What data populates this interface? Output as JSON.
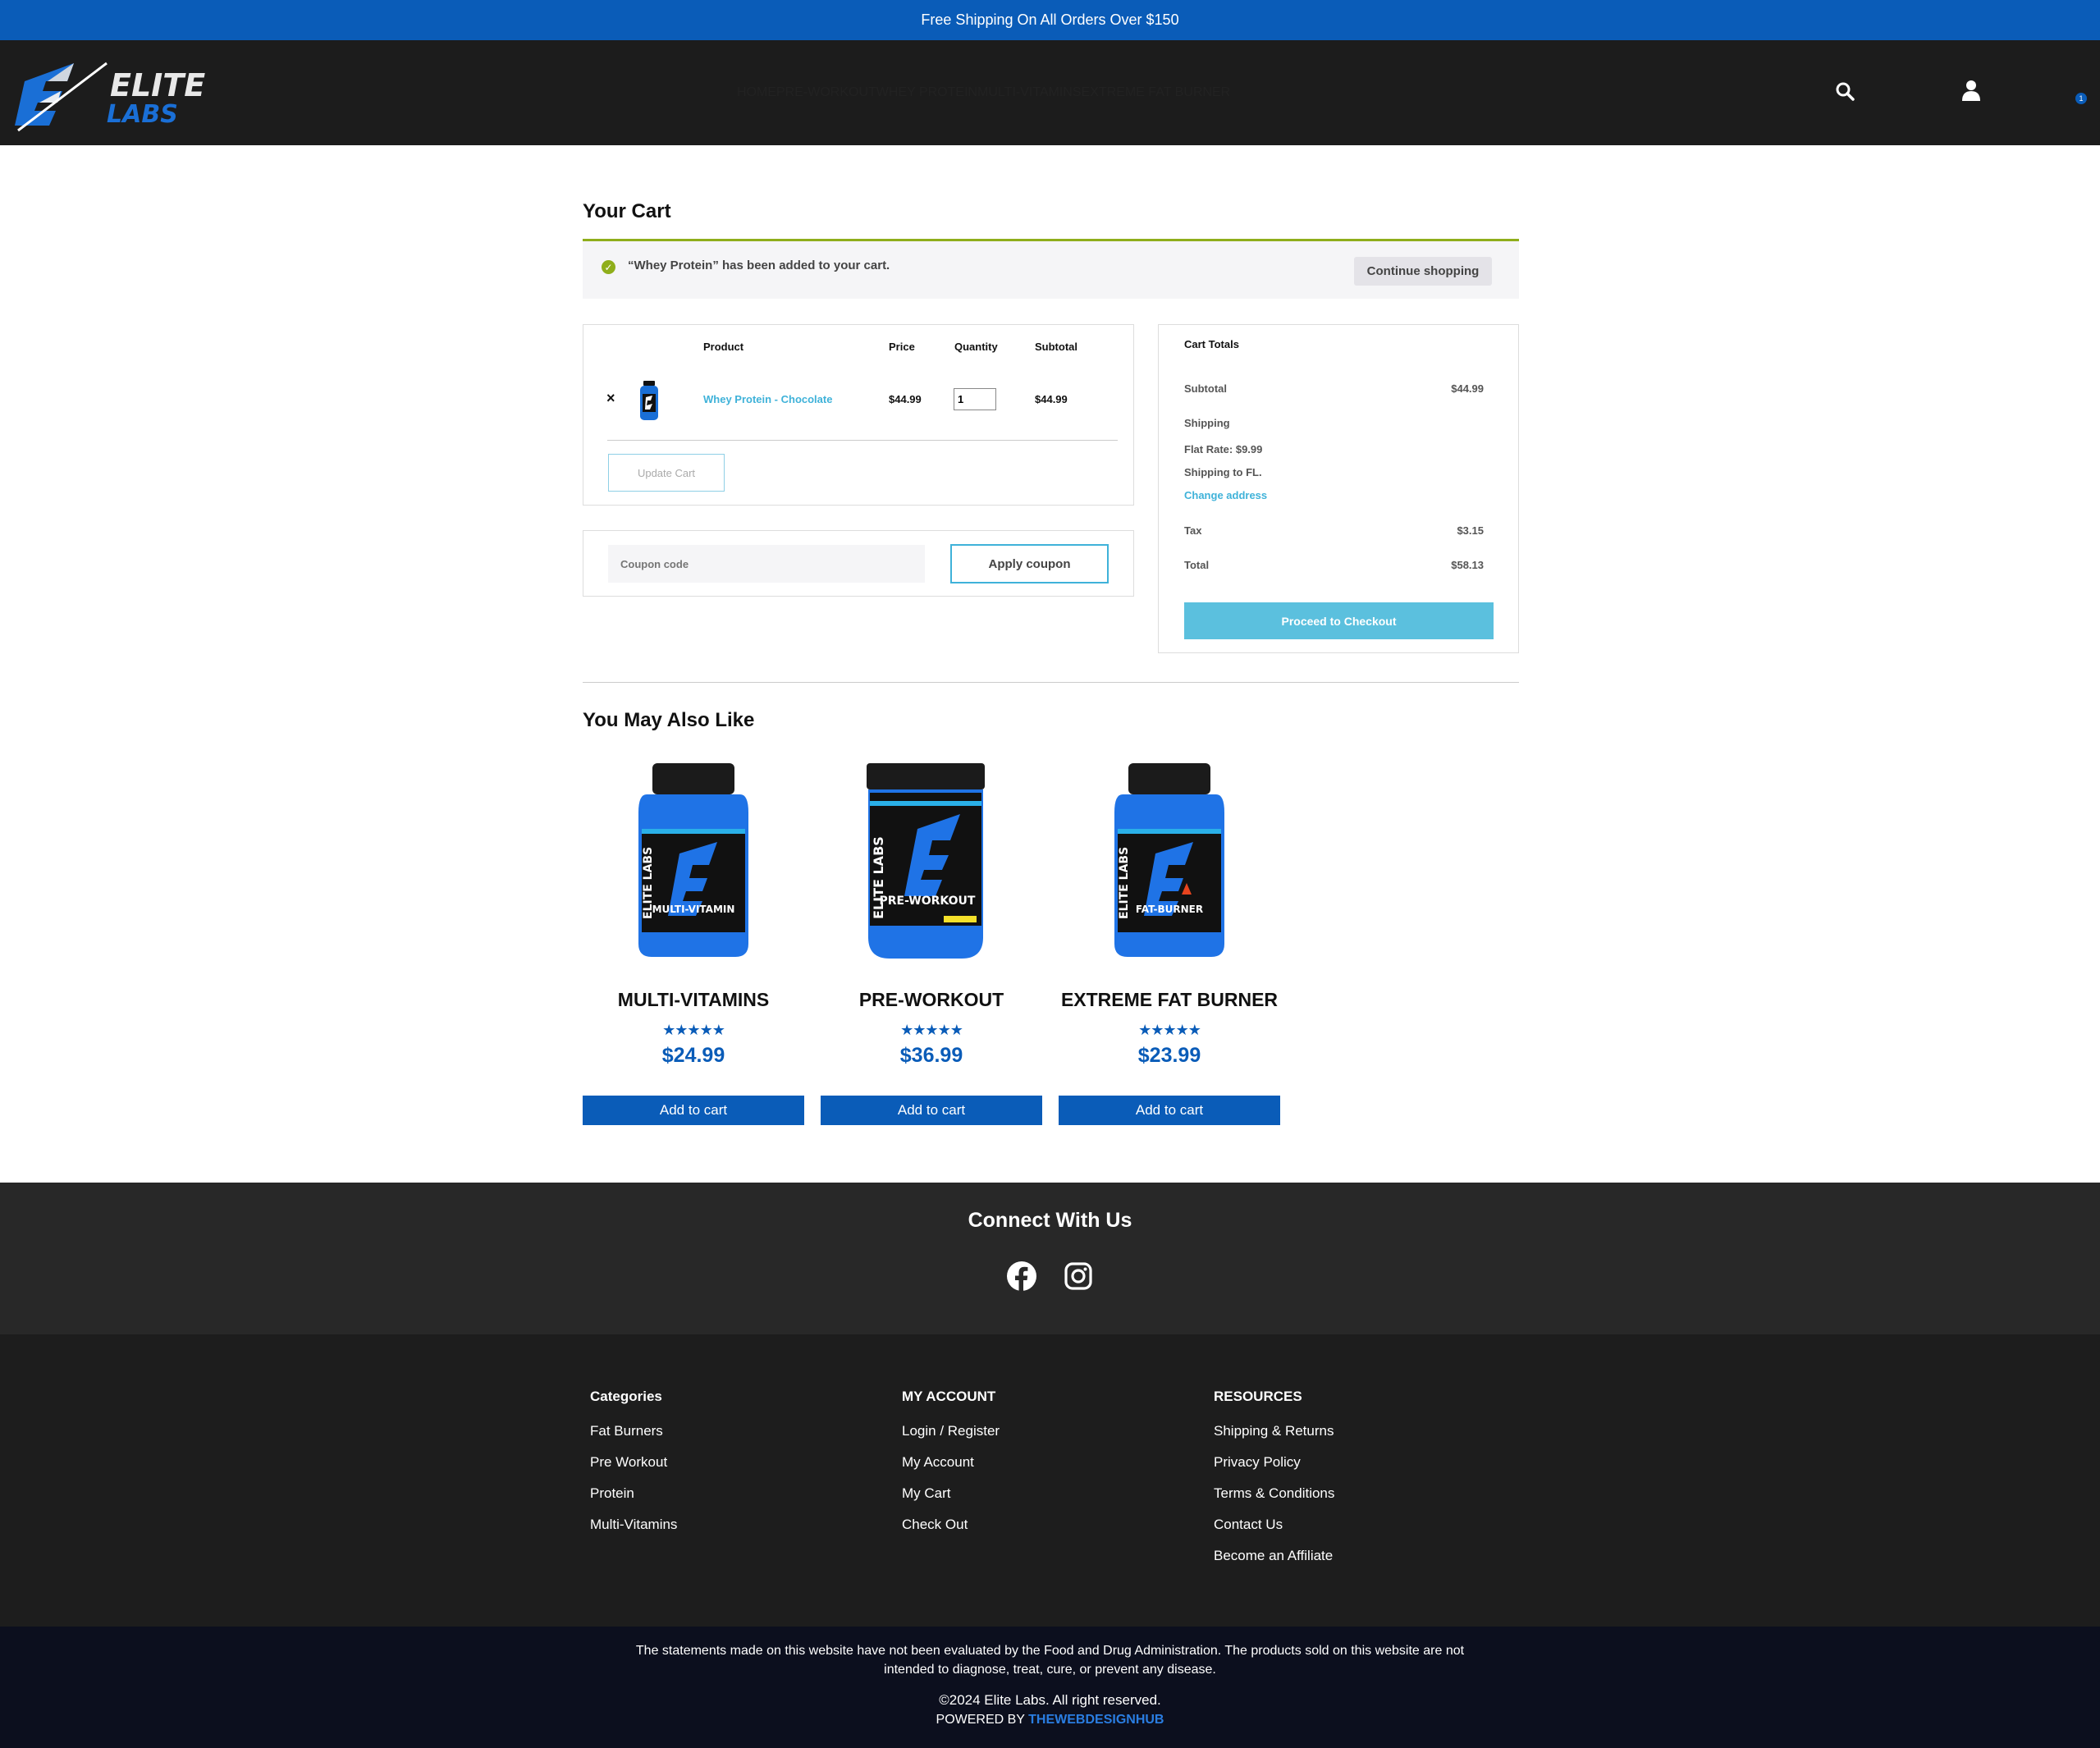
{
  "announcement": "Free Shipping On All Orders Over $150",
  "header": {
    "logo_text_top": "ELITE",
    "logo_text_bottom": "LABS",
    "nav": [
      "HOME",
      "PRE-WORKOUT",
      "WHEY PROTEIN",
      "MULTI-VITAMINS",
      "EXTREME FAT BURNER"
    ],
    "cart_count": "1"
  },
  "cart": {
    "title": "Your Cart",
    "notice": "“Whey Protein” has been added to your cart.",
    "continue_label": "Continue shopping",
    "columns": [
      "Product",
      "Price",
      "Quantity",
      "Subtotal"
    ],
    "item": {
      "remove": "×",
      "name": "Whey Protein - Chocolate",
      "price": "$44.99",
      "quantity": "1",
      "subtotal": "$44.99"
    },
    "update_label": "Update Cart",
    "coupon_placeholder": "Coupon code",
    "apply_label": "Apply coupon"
  },
  "totals": {
    "title": "Cart Totals",
    "subtotal_label": "Subtotal",
    "subtotal_value": "$44.99",
    "shipping_label": "Shipping",
    "flat_rate": "Flat Rate: $9.99",
    "shipping_to": "Shipping to FL.",
    "change_address": "Change address",
    "tax_label": "Tax",
    "tax_value": "$3.15",
    "total_label": "Total",
    "total_value": "$58.13",
    "checkout_label": "Proceed to Checkout"
  },
  "related": {
    "title": "You May Also Like",
    "products": [
      {
        "name": "MULTI-VITAMINS",
        "stars": "★★★★★",
        "rating": 5,
        "price": "$24.99",
        "button": "Add to cart",
        "label": "MULTI-VITAMIN"
      },
      {
        "name": "PRE-WORKOUT",
        "stars": "★★★★★",
        "rating": 5,
        "price": "$36.99",
        "button": "Add to cart",
        "label": "PRE-WORKOUT"
      },
      {
        "name": "EXTREME FAT BURNER",
        "stars": "★★★★★",
        "rating": 5,
        "price": "$23.99",
        "button": "Add to cart",
        "label": "FAT-BURNER"
      }
    ]
  },
  "connect": {
    "title": "Connect With Us",
    "icons": [
      "facebook-icon",
      "instagram-icon"
    ]
  },
  "footer": {
    "categories": {
      "title": "Categories",
      "links": [
        "Fat Burners",
        "Pre Workout",
        "Protein",
        "Multi-Vitamins"
      ]
    },
    "account": {
      "title": "MY ACCOUNT",
      "links": [
        "Login / Register",
        "My Account",
        "My Cart",
        "Check Out"
      ]
    },
    "resources": {
      "title": "RESOURCES",
      "links": [
        "Shipping & Returns",
        "Privacy Policy",
        "Terms & Conditions",
        "Contact Us",
        "Become an Affiliate"
      ]
    }
  },
  "bottom": {
    "disclaimer_1": "The statements made on this website have not been evaluated by the Food and Drug Administration. The products sold on this website are not",
    "disclaimer_2": "intended to diagnose, treat, cure, or prevent any disease.",
    "copyright": "©2024 Elite Labs. All right reserved.",
    "powered_prefix": "POWERED BY ",
    "powered_link": "THEWEBDESIGNHUB"
  },
  "colors": {
    "brand_blue": "#0a5cb8",
    "accent_cyan": "#3fb2d9",
    "success_green": "#8fae1b",
    "header_dark": "#1c1c1c"
  }
}
